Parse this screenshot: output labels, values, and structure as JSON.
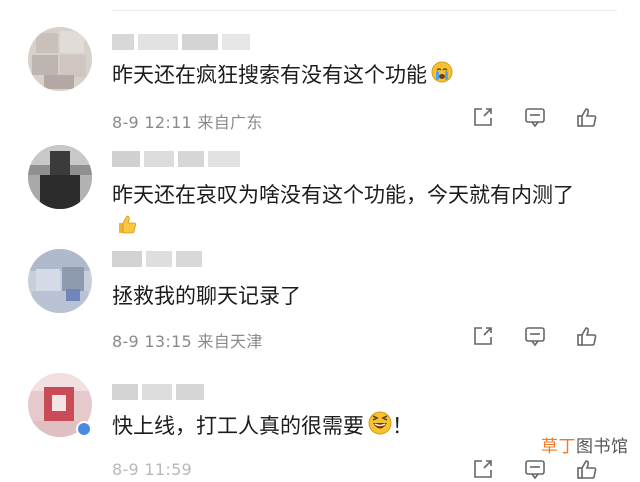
{
  "comments": [
    {
      "text": "昨天还在疯狂搜索有没有这个功能",
      "emoji": "crying-face-emoji",
      "meta": "8-9 12:11 来自广东"
    },
    {
      "text": "昨天还在哀叹为啥没有这个功能，今天就有内测了",
      "emoji": "thumbs-up-emoji",
      "meta": ""
    },
    {
      "text": "拯救我的聊天记录了",
      "emoji": "",
      "meta": "8-9 13:15 来自天津"
    },
    {
      "text": "快上线，打工人真的很需要",
      "emoji": "laughing-face-emoji",
      "text_suffix": "！",
      "meta": "8-9 11:59"
    }
  ],
  "actions": [
    "share-icon",
    "comment-icon",
    "like-icon"
  ],
  "watermark": {
    "part1": "草丁",
    "part2": "图书馆"
  },
  "colors": {
    "meta": "#8a8a8a",
    "text": "#1c1c1c",
    "watermark_accent": "#f07a2a",
    "badge": "#4a8ae0"
  }
}
